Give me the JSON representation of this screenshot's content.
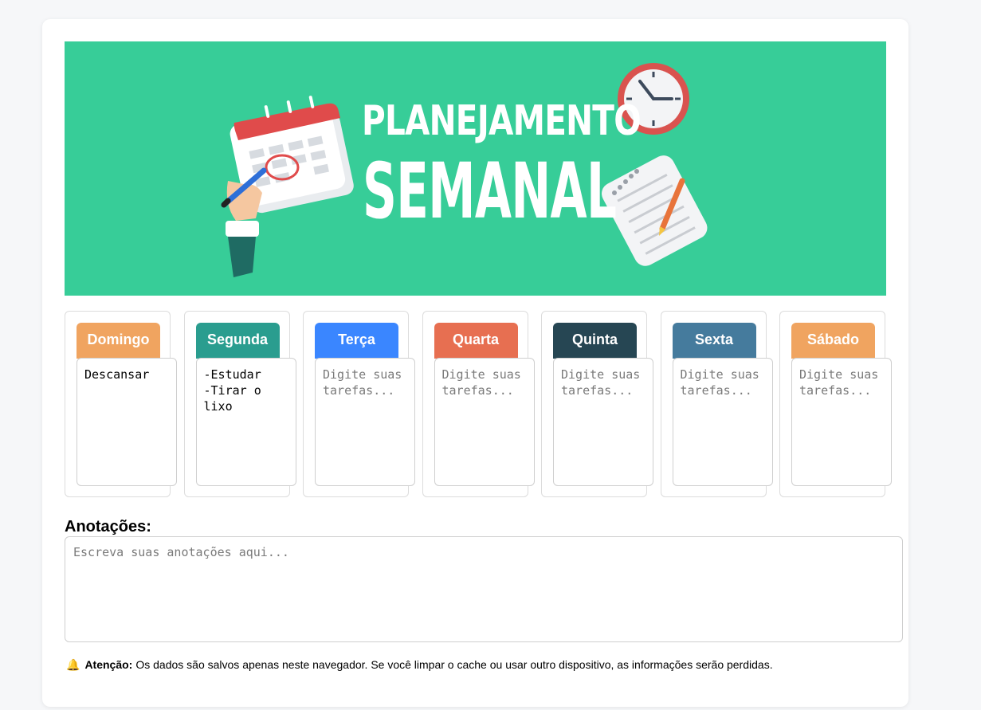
{
  "banner": {
    "title_line1": "PLANEJAMENTO",
    "title_line2": "SEMANAL",
    "background": "#37cd98"
  },
  "days": [
    {
      "label": "Domingo",
      "color": "#f0a460",
      "text": "Descansar",
      "placeholder": "Digite suas tarefas..."
    },
    {
      "label": "Segunda",
      "color": "#2a9d8f",
      "text": "-Estudar\n-Tirar o lixo",
      "placeholder": "Digite suas tarefas..."
    },
    {
      "label": "Terça",
      "color": "#3a86ff",
      "text": "",
      "placeholder": "Digite suas tarefas..."
    },
    {
      "label": "Quarta",
      "color": "#e76f51",
      "text": "",
      "placeholder": "Digite suas tarefas..."
    },
    {
      "label": "Quinta",
      "color": "#264653",
      "text": "",
      "placeholder": "Digite suas tarefas..."
    },
    {
      "label": "Sexta",
      "color": "#457b9d",
      "text": "",
      "placeholder": "Digite suas tarefas..."
    },
    {
      "label": "Sábado",
      "color": "#f0a460",
      "text": "",
      "placeholder": "Digite suas tarefas..."
    }
  ],
  "notes": {
    "title": "Anotações:",
    "placeholder": "Escreva suas anotações aqui...",
    "value": ""
  },
  "warning": {
    "icon": "bell-icon",
    "label": "Atenção:",
    "text": "Os dados são salvos apenas neste navegador. Se você limpar o cache ou usar outro dispositivo, as informações serão perdidas."
  }
}
